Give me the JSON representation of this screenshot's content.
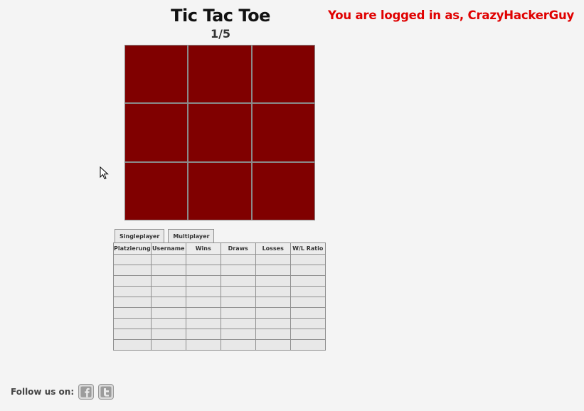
{
  "header": {
    "title": "Tic Tac Toe",
    "round": "1/5",
    "login_text": "You are logged in as, CrazyHackerGuy"
  },
  "board": {
    "cells": [
      "",
      "",
      "",
      "",
      "",
      "",
      "",
      "",
      ""
    ],
    "cell_color": "#800000"
  },
  "tabs": [
    {
      "label": "Singleplayer"
    },
    {
      "label": "Multiplayer"
    }
  ],
  "table": {
    "columns": [
      "Platzierung",
      "Username",
      "Wins",
      "Draws",
      "Losses",
      "W/L Ratio"
    ],
    "rows": [
      [
        "",
        "",
        "",
        "",
        "",
        ""
      ],
      [
        "",
        "",
        "",
        "",
        "",
        ""
      ],
      [
        "",
        "",
        "",
        "",
        "",
        ""
      ],
      [
        "",
        "",
        "",
        "",
        "",
        ""
      ],
      [
        "",
        "",
        "",
        "",
        "",
        ""
      ],
      [
        "",
        "",
        "",
        "",
        "",
        ""
      ],
      [
        "",
        "",
        "",
        "",
        "",
        ""
      ],
      [
        "",
        "",
        "",
        "",
        "",
        ""
      ],
      [
        "",
        "",
        "",
        "",
        "",
        ""
      ]
    ]
  },
  "footer": {
    "follow_label": "Follow us on:",
    "social": [
      {
        "icon": "facebook-icon"
      },
      {
        "icon": "twitter-icon"
      }
    ]
  },
  "colors": {
    "login": "#e00000",
    "background": "#f4f4f4",
    "cell": "#800000"
  }
}
